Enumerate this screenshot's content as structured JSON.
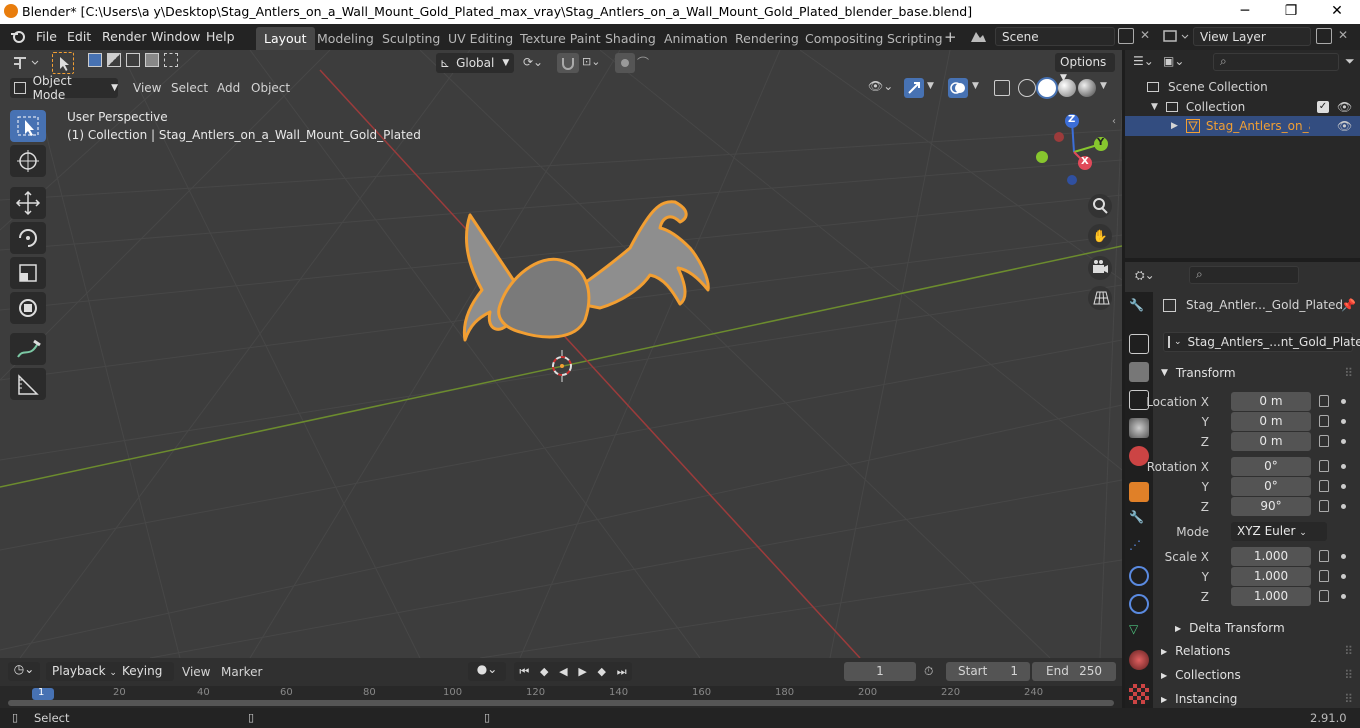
{
  "window": {
    "title": "Blender* [C:\\Users\\a y\\Desktop\\Stag_Antlers_on_a_Wall_Mount_Gold_Plated_max_vray\\Stag_Antlers_on_a_Wall_Mount_Gold_Plated_blender_base.blend]",
    "minimize": "─",
    "maximize": "❐",
    "close": "✕"
  },
  "menu": [
    "File",
    "Edit",
    "Render",
    "Window",
    "Help"
  ],
  "workspaces": [
    "Layout",
    "Modeling",
    "Sculpting",
    "UV Editing",
    "Texture Paint",
    "Shading",
    "Animation",
    "Rendering",
    "Compositing",
    "Scripting"
  ],
  "scene": {
    "name": "Scene",
    "view_layer": "View Layer"
  },
  "viewport": {
    "orientation": "Global",
    "options": "Options",
    "mode": "Object Mode",
    "header_menus": [
      "View",
      "Select",
      "Add",
      "Object"
    ],
    "info_line1": "User Perspective",
    "info_line2": "(1) Collection | Stag_Antlers_on_a_Wall_Mount_Gold_Plated",
    "gizmo": {
      "x": "X",
      "y": "Y",
      "z": "Z"
    }
  },
  "outliner": {
    "scene_collection": "Scene Collection",
    "collection": "Collection",
    "object": "Stag_Antlers_on_a_W"
  },
  "properties": {
    "object_name": "Stag_Antler..._Gold_Plated",
    "data_name": "Stag_Antlers_...nt_Gold_Plated",
    "transform": "Transform",
    "location_label": "Location X",
    "rotation_label": "Rotation X",
    "scale_label": "Scale X",
    "y": "Y",
    "z": "Z",
    "location": [
      "0 m",
      "0 m",
      "0 m"
    ],
    "rotation": [
      "0°",
      "0°",
      "90°"
    ],
    "mode_label": "Mode",
    "mode_value": "XYZ Euler",
    "scale": [
      "1.000",
      "1.000",
      "1.000"
    ],
    "delta": "Delta Transform",
    "sections": [
      "Relations",
      "Collections",
      "Instancing"
    ]
  },
  "timeline": {
    "menus": [
      "Playback",
      "Keying",
      "View",
      "Marker"
    ],
    "current_frame": "1",
    "start_label": "Start",
    "start": "1",
    "end_label": "End",
    "end": "250",
    "ruler": [
      "1",
      "20",
      "40",
      "60",
      "80",
      "100",
      "120",
      "140",
      "160",
      "180",
      "200",
      "220",
      "240"
    ]
  },
  "status": {
    "left": "Select",
    "version": "2.91.0"
  },
  "colors": {
    "accent": "#4772b3",
    "selection_outline": "#f29f33",
    "x_axis": "#9c3b3b",
    "y_axis": "#6c8c2e"
  }
}
